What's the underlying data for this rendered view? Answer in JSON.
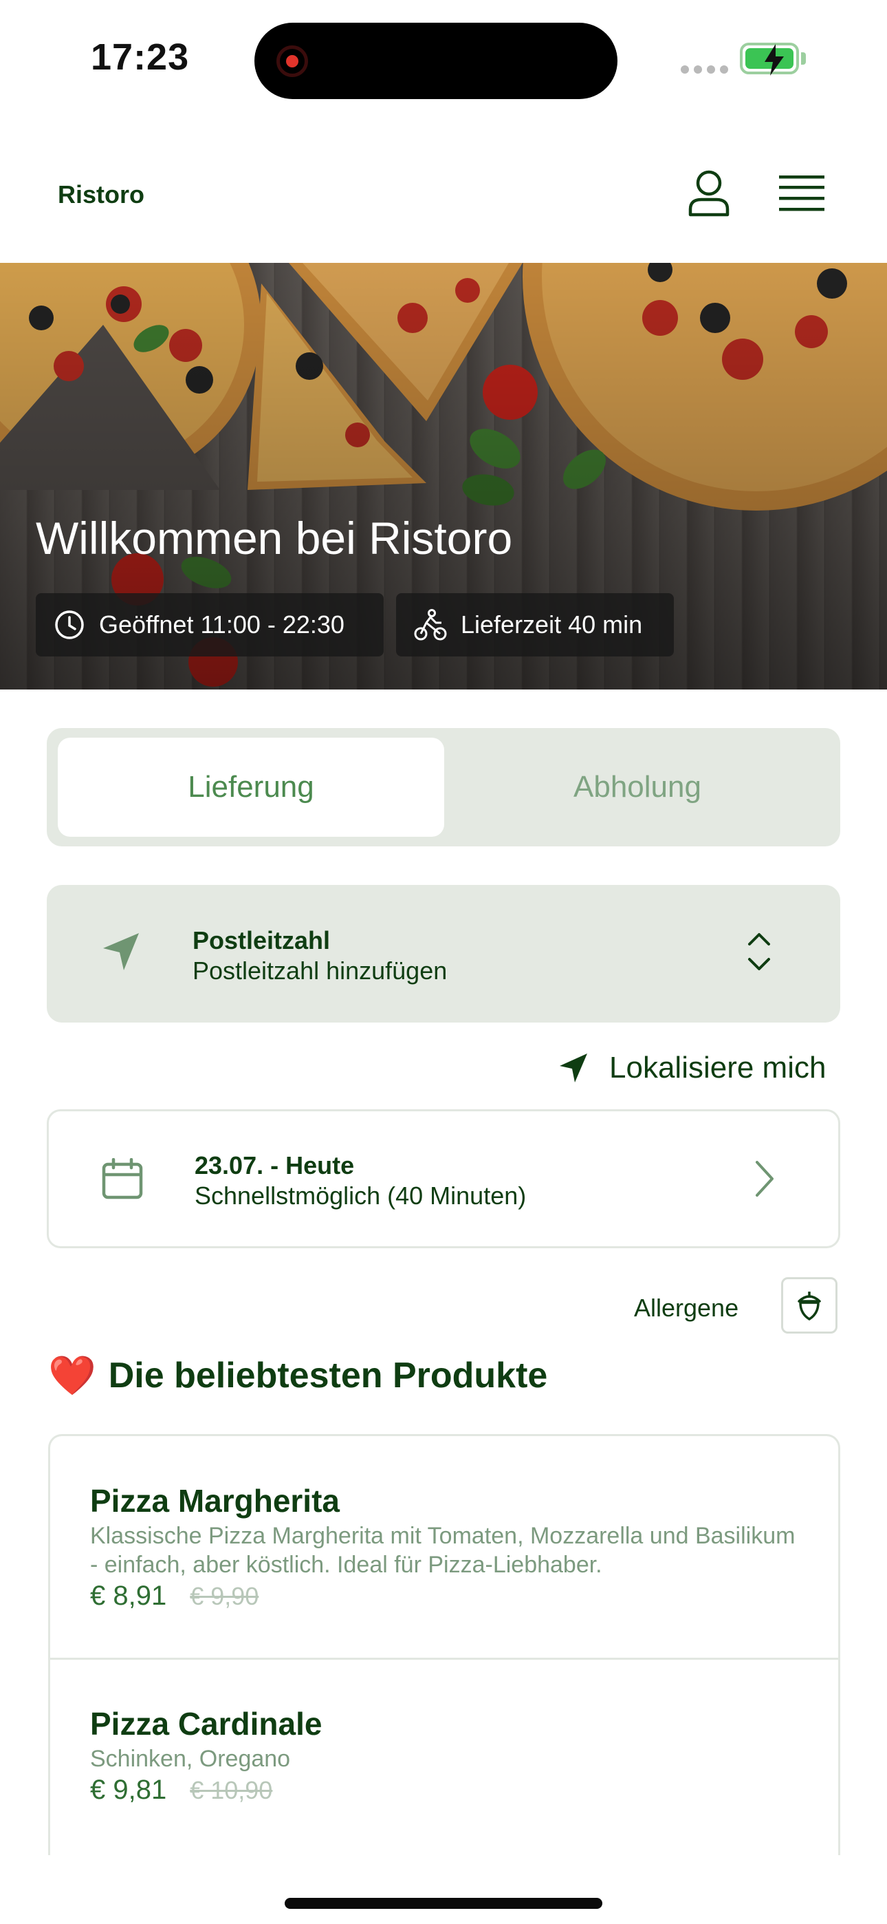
{
  "status_bar": {
    "time": "17:23"
  },
  "header": {
    "brand": "Ristoro",
    "profile_icon": "user-icon",
    "menu_icon": "hamburger-menu-icon"
  },
  "hero": {
    "title": "Willkommen bei Ristoro",
    "opening_hours": "Geöffnet 11:00 - 22:30",
    "delivery_time": "Lieferzeit 40 min"
  },
  "mode_tabs": {
    "delivery": "Lieferung",
    "pickup": "Abholung",
    "selected": "Lieferung"
  },
  "postal": {
    "title": "Postleitzahl",
    "subtitle": "Postleitzahl hinzufügen"
  },
  "locate": {
    "label": "Lokalisiere mich"
  },
  "date": {
    "title": "23.07. - Heute",
    "subtitle": "Schnellstmöglich (40 Minuten)"
  },
  "allergens": {
    "label": "Allergene"
  },
  "popular": {
    "emoji": "❤️",
    "title": "Die beliebtesten Produkte",
    "products": [
      {
        "name": "Pizza Margherita",
        "description": "Klassische Pizza Margherita mit Tomaten, Mozzarella und Basilikum - einfach, aber köstlich. Ideal für Pizza-Liebhaber.",
        "price": "€ 8,91",
        "old_price": "€ 9,90"
      },
      {
        "name": "Pizza Cardinale",
        "description": "Schinken, Oregano",
        "price": "€ 9,81",
        "old_price": "€ 10,90"
      }
    ]
  },
  "colors": {
    "primary_dark": "#0f3d12",
    "primary": "#4c8a4f",
    "panel": "#e4e9e2",
    "muted": "#7c9a7f"
  }
}
